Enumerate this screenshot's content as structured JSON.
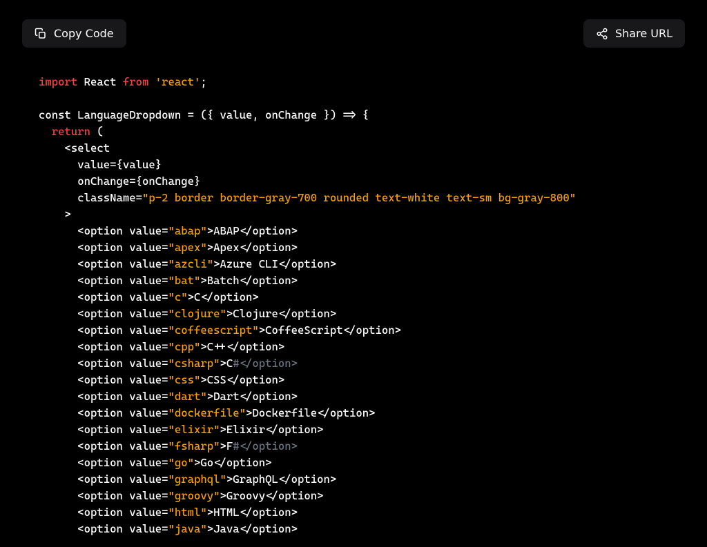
{
  "toolbar": {
    "copy_label": "Copy Code",
    "share_label": "Share URL"
  },
  "code": {
    "line1_import": "import",
    "line1_react": " React ",
    "line1_from": "from",
    "line1_space": " ",
    "line1_module": "'react'",
    "line1_semi": ";",
    "line3": "const LanguageDropdown = ({ value, onChange }) => {",
    "line4_pad": "  ",
    "line4_return": "return",
    "line4_paren": " (",
    "line5": "    <select",
    "line6": "      value={value}",
    "line7": "      onChange={onChange}",
    "line8_pre": "      className=",
    "line8_str": "\"p-2 border border-gray-700 rounded text-white text-sm bg-gray-800\"",
    "line9": "    >",
    "opt_pre": "      <option value=",
    "opt_close": "</option>",
    "options": [
      {
        "val": "\"abap\"",
        "after": ">ABAP</option>"
      },
      {
        "val": "\"apex\"",
        "after": ">Apex</option>"
      },
      {
        "val": "\"azcli\"",
        "after": ">Azure CLI</option>"
      },
      {
        "val": "\"bat\"",
        "after": ">Batch</option>"
      },
      {
        "val": "\"c\"",
        "after": ">C</option>"
      },
      {
        "val": "\"clojure\"",
        "after": ">Clojure</option>"
      },
      {
        "val": "\"coffeescript\"",
        "after": ">CoffeeScript</option>"
      },
      {
        "val": "\"cpp\"",
        "after": ">C++</option>"
      },
      {
        "val": "\"csharp\"",
        "after": ">C",
        "comment": "#</option>"
      },
      {
        "val": "\"css\"",
        "after": ">CSS</option>"
      },
      {
        "val": "\"dart\"",
        "after": ">Dart</option>"
      },
      {
        "val": "\"dockerfile\"",
        "after": ">Dockerfile</option>"
      },
      {
        "val": "\"elixir\"",
        "after": ">Elixir</option>"
      },
      {
        "val": "\"fsharp\"",
        "after": ">F",
        "comment": "#</option>"
      },
      {
        "val": "\"go\"",
        "after": ">Go</option>"
      },
      {
        "val": "\"graphql\"",
        "after": ">GraphQL</option>"
      },
      {
        "val": "\"groovy\"",
        "after": ">Groovy</option>"
      },
      {
        "val": "\"html\"",
        "after": ">HTML</option>"
      },
      {
        "val": "\"java\"",
        "after": ">Java</option>"
      }
    ]
  }
}
